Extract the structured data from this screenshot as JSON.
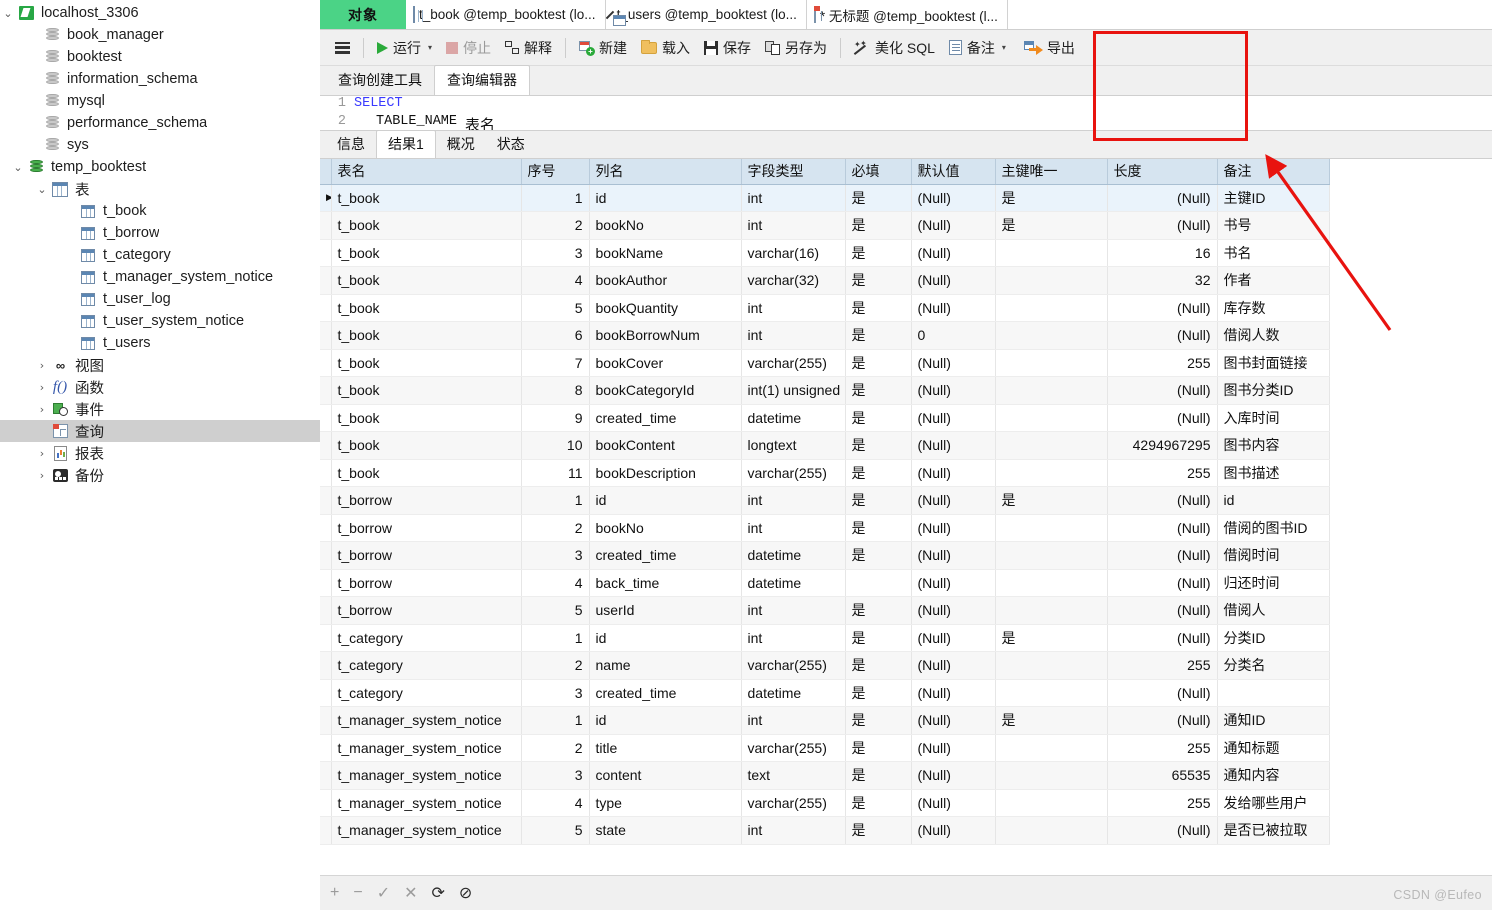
{
  "sidebar": {
    "connection": {
      "label": "localhost_3306",
      "icon": "connection-icon"
    },
    "databases": [
      {
        "label": "book_manager",
        "icon": "database-icon"
      },
      {
        "label": "booktest",
        "icon": "database-icon"
      },
      {
        "label": "information_schema",
        "icon": "database-icon"
      },
      {
        "label": "mysql",
        "icon": "database-icon"
      },
      {
        "label": "performance_schema",
        "icon": "database-icon"
      },
      {
        "label": "sys",
        "icon": "database-icon"
      }
    ],
    "active_database": {
      "label": "temp_booktest",
      "icon": "database-icon-active"
    },
    "tables_group": {
      "label": "表",
      "icon": "table-icon"
    },
    "tables": [
      {
        "label": "t_book"
      },
      {
        "label": "t_borrow"
      },
      {
        "label": "t_category"
      },
      {
        "label": "t_manager_system_notice"
      },
      {
        "label": "t_user_log"
      },
      {
        "label": "t_user_system_notice"
      },
      {
        "label": "t_users"
      }
    ],
    "groups": [
      {
        "label": "视图",
        "icon": "view-icon",
        "selected": false
      },
      {
        "label": "函数",
        "icon": "function-icon",
        "selected": false
      },
      {
        "label": "事件",
        "icon": "event-icon",
        "selected": false
      },
      {
        "label": "查询",
        "icon": "query-icon",
        "selected": true
      },
      {
        "label": "报表",
        "icon": "report-icon",
        "selected": false
      },
      {
        "label": "备份",
        "icon": "backup-icon",
        "selected": false
      }
    ]
  },
  "tabstrip": {
    "object_tab": "对象",
    "editor_tabs": [
      {
        "label": "t_book @temp_booktest (lo...",
        "icon": "table-icon",
        "active": false
      },
      {
        "label": "t_users @temp_booktest (lo...",
        "icon": "table-edit-icon",
        "active": false
      },
      {
        "label": "* 无标题 @temp_booktest (l...",
        "icon": "query-icon",
        "active": true
      }
    ]
  },
  "toolbar": {
    "menu_label": "",
    "items": [
      {
        "label": "运行",
        "icon": "play-icon",
        "disabled": false,
        "has_caret": true
      },
      {
        "label": "停止",
        "icon": "stop-icon",
        "disabled": true,
        "has_caret": false
      },
      {
        "label": "解释",
        "icon": "explain-icon",
        "disabled": false,
        "has_caret": false
      },
      {
        "label": "新建",
        "icon": "new-query-icon",
        "disabled": false,
        "has_caret": false
      },
      {
        "label": "载入",
        "icon": "folder-icon",
        "disabled": false,
        "has_caret": false
      },
      {
        "label": "保存",
        "icon": "save-icon",
        "disabled": false,
        "has_caret": false
      },
      {
        "label": "另存为",
        "icon": "save-as-icon",
        "disabled": false,
        "has_caret": false
      },
      {
        "label": "美化 SQL",
        "icon": "wand-icon",
        "disabled": false,
        "has_caret": false
      },
      {
        "label": "备注",
        "icon": "note-icon",
        "disabled": false,
        "has_caret": true
      },
      {
        "label": "导出",
        "icon": "export-icon",
        "disabled": false,
        "has_caret": false
      }
    ]
  },
  "subtabs": [
    {
      "label": "查询创建工具",
      "active": false
    },
    {
      "label": "查询编辑器",
      "active": true
    }
  ],
  "sql": {
    "line1_no": "1",
    "line1_kw": "SELECT",
    "line2_no": "2",
    "line2_col": "TABLE_NAME",
    "line2_alias": "表名"
  },
  "result_tabs": [
    {
      "label": "信息",
      "active": false
    },
    {
      "label": "结果1",
      "active": true
    },
    {
      "label": "概况",
      "active": false
    },
    {
      "label": "状态",
      "active": false
    }
  ],
  "grid": {
    "columns": [
      "表名",
      "序号",
      "列名",
      "字段类型",
      "必填",
      "默认值",
      "主键唯一",
      "长度",
      "备注"
    ],
    "rows": [
      {
        "selected": true,
        "cells": [
          "t_book",
          "1",
          "id",
          "int",
          "是",
          "(Null)",
          "是",
          "(Null)",
          "主键ID"
        ]
      },
      {
        "selected": false,
        "cells": [
          "t_book",
          "2",
          "bookNo",
          "int",
          "是",
          "(Null)",
          "是",
          "(Null)",
          "书号"
        ]
      },
      {
        "selected": false,
        "cells": [
          "t_book",
          "3",
          "bookName",
          "varchar(16)",
          "是",
          "(Null)",
          "",
          "16",
          "书名"
        ]
      },
      {
        "selected": false,
        "cells": [
          "t_book",
          "4",
          "bookAuthor",
          "varchar(32)",
          "是",
          "(Null)",
          "",
          "32",
          "作者"
        ]
      },
      {
        "selected": false,
        "cells": [
          "t_book",
          "5",
          "bookQuantity",
          "int",
          "是",
          "(Null)",
          "",
          "(Null)",
          "库存数"
        ]
      },
      {
        "selected": false,
        "cells": [
          "t_book",
          "6",
          "bookBorrowNum",
          "int",
          "是",
          "0",
          "",
          "(Null)",
          "借阅人数"
        ]
      },
      {
        "selected": false,
        "cells": [
          "t_book",
          "7",
          "bookCover",
          "varchar(255)",
          "是",
          "(Null)",
          "",
          "255",
          "图书封面链接"
        ]
      },
      {
        "selected": false,
        "cells": [
          "t_book",
          "8",
          "bookCategoryId",
          "int(1) unsigned",
          "是",
          "(Null)",
          "",
          "(Null)",
          "图书分类ID"
        ]
      },
      {
        "selected": false,
        "cells": [
          "t_book",
          "9",
          "created_time",
          "datetime",
          "是",
          "(Null)",
          "",
          "(Null)",
          "入库时间"
        ]
      },
      {
        "selected": false,
        "cells": [
          "t_book",
          "10",
          "bookContent",
          "longtext",
          "是",
          "(Null)",
          "",
          "4294967295",
          "图书内容"
        ]
      },
      {
        "selected": false,
        "cells": [
          "t_book",
          "11",
          "bookDescription",
          "varchar(255)",
          "是",
          "(Null)",
          "",
          "255",
          "图书描述"
        ]
      },
      {
        "selected": false,
        "cells": [
          "t_borrow",
          "1",
          "id",
          "int",
          "是",
          "(Null)",
          "是",
          "(Null)",
          "id"
        ]
      },
      {
        "selected": false,
        "cells": [
          "t_borrow",
          "2",
          "bookNo",
          "int",
          "是",
          "(Null)",
          "",
          "(Null)",
          "借阅的图书ID"
        ]
      },
      {
        "selected": false,
        "cells": [
          "t_borrow",
          "3",
          "created_time",
          "datetime",
          "是",
          "(Null)",
          "",
          "(Null)",
          "借阅时间"
        ]
      },
      {
        "selected": false,
        "cells": [
          "t_borrow",
          "4",
          "back_time",
          "datetime",
          "",
          "(Null)",
          "",
          "(Null)",
          "归还时间"
        ]
      },
      {
        "selected": false,
        "cells": [
          "t_borrow",
          "5",
          "userId",
          "int",
          "是",
          "(Null)",
          "",
          "(Null)",
          "借阅人"
        ]
      },
      {
        "selected": false,
        "cells": [
          "t_category",
          "1",
          "id",
          "int",
          "是",
          "(Null)",
          "是",
          "(Null)",
          "分类ID"
        ]
      },
      {
        "selected": false,
        "cells": [
          "t_category",
          "2",
          "name",
          "varchar(255)",
          "是",
          "(Null)",
          "",
          "255",
          "分类名"
        ]
      },
      {
        "selected": false,
        "cells": [
          "t_category",
          "3",
          "created_time",
          "datetime",
          "是",
          "(Null)",
          "",
          "(Null)",
          ""
        ]
      },
      {
        "selected": false,
        "cells": [
          "t_manager_system_notice",
          "1",
          "id",
          "int",
          "是",
          "(Null)",
          "是",
          "(Null)",
          "通知ID"
        ]
      },
      {
        "selected": false,
        "cells": [
          "t_manager_system_notice",
          "2",
          "title",
          "varchar(255)",
          "是",
          "(Null)",
          "",
          "255",
          "通知标题"
        ]
      },
      {
        "selected": false,
        "cells": [
          "t_manager_system_notice",
          "3",
          "content",
          "text",
          "是",
          "(Null)",
          "",
          "65535",
          "通知内容"
        ]
      },
      {
        "selected": false,
        "cells": [
          "t_manager_system_notice",
          "4",
          "type",
          "varchar(255)",
          "是",
          "(Null)",
          "",
          "255",
          "发给哪些用户"
        ]
      },
      {
        "selected": false,
        "cells": [
          "t_manager_system_notice",
          "5",
          "state",
          "int",
          "是",
          "(Null)",
          "",
          "(Null)",
          "是否已被拉取"
        ]
      }
    ]
  },
  "bottom_bar": {
    "buttons": [
      {
        "icon": "plus-icon",
        "enabled": false,
        "glyph": "+"
      },
      {
        "icon": "minus-icon",
        "enabled": false,
        "glyph": "−"
      },
      {
        "icon": "check-icon",
        "enabled": false,
        "glyph": "✓"
      },
      {
        "icon": "cross-icon",
        "enabled": false,
        "glyph": "✕"
      },
      {
        "icon": "refresh-icon",
        "enabled": true,
        "glyph": "⟳"
      },
      {
        "icon": "stop-circle-icon",
        "enabled": true,
        "glyph": "⊘"
      }
    ]
  },
  "watermark": "CSDN @Eufeo",
  "annotation": {
    "box_color": "#e8130f",
    "arrow_color": "#e8130f"
  }
}
